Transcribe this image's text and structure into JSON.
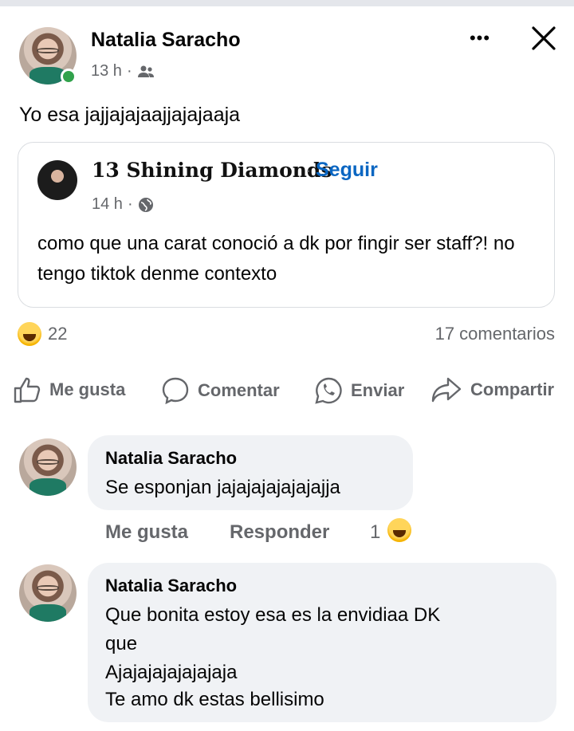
{
  "post": {
    "author": "Natalia Saracho",
    "time": "13 h",
    "separator": "·",
    "audience_icon": "friends-icon",
    "text": "Yo esa jajjajajaajjajajaaja"
  },
  "header_actions": {
    "more_icon": "more-icon",
    "close_icon": "close-icon",
    "more_label": "•••",
    "close_label": "✕"
  },
  "shared_post": {
    "page_name": "13 Shining Diamonds",
    "separator": "·",
    "follow_label": "Seguir",
    "time": "14 h",
    "audience_icon": "globe-icon",
    "text": "como que una carat conoció a dk por fingir ser staff?! no tengo tiktok denme contexto"
  },
  "reactions": {
    "count": "22",
    "emoji": "haha-emoji-icon",
    "comments_count": "17 comentarios"
  },
  "actions": [
    {
      "label": "Me gusta",
      "icon": "like-icon"
    },
    {
      "label": "Comentar",
      "icon": "comment-icon"
    },
    {
      "label": "Enviar",
      "icon": "whatsapp-icon"
    },
    {
      "label": "Compartir",
      "icon": "share-icon"
    }
  ],
  "comments": [
    {
      "author": "Natalia Saracho",
      "lines": [
        "Se esponjan jajajajajajajajja"
      ],
      "like_label": "Me gusta",
      "reply_label": "Responder",
      "reaction_count": "1"
    },
    {
      "author": "Natalia Saracho",
      "lines": [
        "Que bonita estoy esa es la envidiaa DK",
        "que",
        "Ajajajajajajajaja",
        "Te amo dk estas bellisimo"
      ]
    }
  ],
  "colors": {
    "link": "#0a66c2",
    "muted": "#65676b",
    "bubble": "#f0f2f5",
    "online": "#31a24c"
  }
}
